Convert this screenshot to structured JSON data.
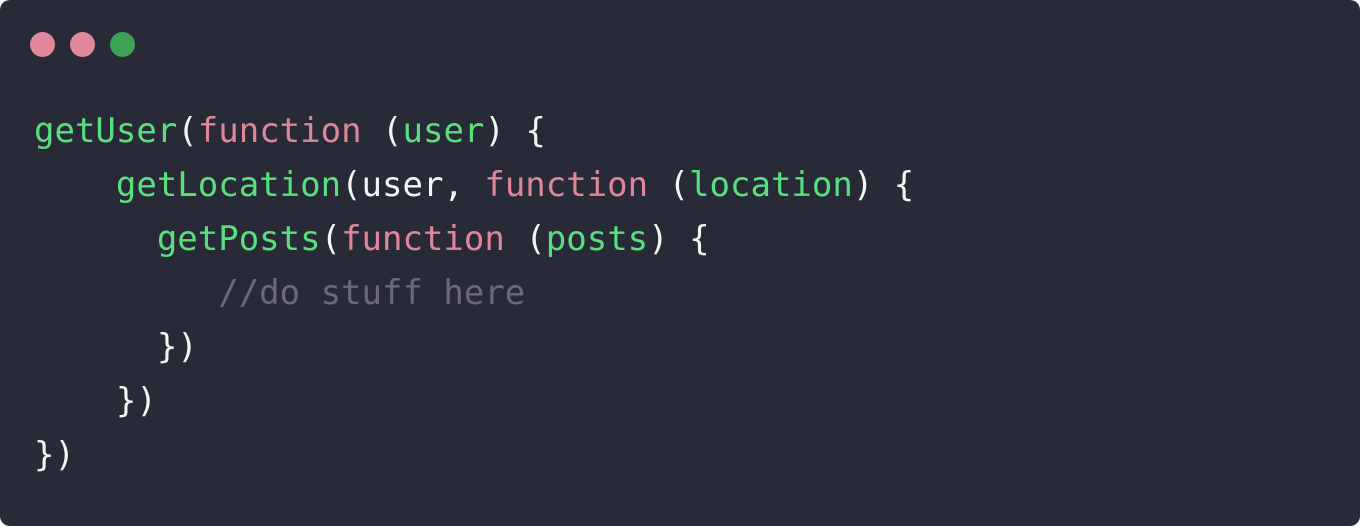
{
  "window": {
    "controls": [
      {
        "name": "close",
        "color": "#e0879c"
      },
      {
        "name": "minimize",
        "color": "#e0879c"
      },
      {
        "name": "maximize",
        "color": "#3da256"
      }
    ]
  },
  "code": {
    "lines": [
      {
        "indent": "",
        "tokens": [
          {
            "t": "getUser",
            "c": "fn"
          },
          {
            "t": "(",
            "c": "pl"
          },
          {
            "t": "function",
            "c": "kw"
          },
          {
            "t": " (",
            "c": "pl"
          },
          {
            "t": "user",
            "c": "fn"
          },
          {
            "t": ") {",
            "c": "pl"
          }
        ]
      },
      {
        "indent": "    ",
        "tokens": [
          {
            "t": "getLocation",
            "c": "fn"
          },
          {
            "t": "(user, ",
            "c": "pl"
          },
          {
            "t": "function",
            "c": "kw"
          },
          {
            "t": " (",
            "c": "pl"
          },
          {
            "t": "location",
            "c": "fn"
          },
          {
            "t": ") {",
            "c": "pl"
          }
        ]
      },
      {
        "indent": "      ",
        "tokens": [
          {
            "t": "getPosts",
            "c": "fn"
          },
          {
            "t": "(",
            "c": "pl"
          },
          {
            "t": "function",
            "c": "kw"
          },
          {
            "t": " (",
            "c": "pl"
          },
          {
            "t": "posts",
            "c": "fn"
          },
          {
            "t": ") {",
            "c": "pl"
          }
        ]
      },
      {
        "indent": "         ",
        "tokens": [
          {
            "t": "//do stuff here",
            "c": "cm"
          }
        ]
      },
      {
        "indent": "      ",
        "tokens": [
          {
            "t": "})",
            "c": "pl"
          }
        ]
      },
      {
        "indent": "    ",
        "tokens": [
          {
            "t": "})",
            "c": "pl"
          }
        ]
      },
      {
        "indent": "",
        "tokens": [
          {
            "t": "})",
            "c": "pl"
          }
        ]
      }
    ]
  }
}
